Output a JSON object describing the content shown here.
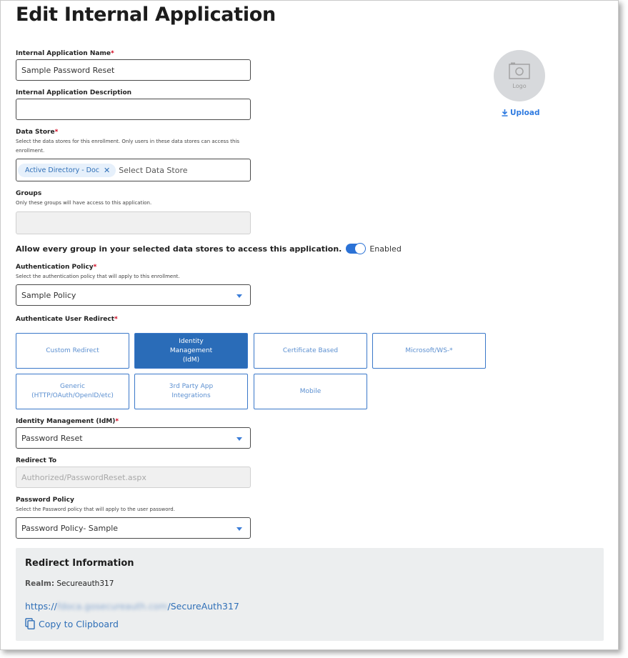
{
  "page_title": "Edit Internal Application",
  "app_name": {
    "label": "Internal Application Name",
    "value": "Sample Password Reset"
  },
  "app_description": {
    "label": "Internal Application Description",
    "value": ""
  },
  "data_store": {
    "label": "Data Store",
    "help": "Select the data stores for this enrollment. Only users in these data stores can access this enrollment.",
    "chip": "Active Directory - Doc",
    "placeholder": "Select Data Store"
  },
  "groups": {
    "label": "Groups",
    "help": "Only these groups will have access to this application.",
    "value": ""
  },
  "allow_all_groups": {
    "label": "Allow every group in your selected data stores to access this application.",
    "state": "Enabled",
    "on": true
  },
  "auth_policy": {
    "label": "Authentication Policy",
    "help": "Select the authentication policy that will apply to this enrollment.",
    "value": "Sample Policy"
  },
  "auth_redirect": {
    "label": "Authenticate User Redirect",
    "options": [
      "Custom Redirect",
      "Identity Management (IdM)",
      "Certificate Based",
      "Microsoft/WS-*",
      "Generic (HTTP/OAuth/OpenID/etc)",
      "3rd Party App Integrations",
      "Mobile"
    ],
    "selected": "Identity Management (IdM)"
  },
  "idm": {
    "label": "Identity Management (IdM)",
    "value": "Password Reset"
  },
  "redirect_to": {
    "label": "Redirect To",
    "value": "Authorized/PasswordReset.aspx"
  },
  "password_policy": {
    "label": "Password Policy",
    "help": "Select the Password policy that will apply to the user password.",
    "value": "Password Policy- Sample"
  },
  "logo": {
    "text": "Logo",
    "upload_label": "Upload"
  },
  "redirect_info": {
    "title": "Redirect Information",
    "realm_label": "Realm:",
    "realm_value": "Secureauth317",
    "url_prefix": "https://",
    "url_host_obscured": "fdoca.gosecureauth.com",
    "url_path": "/SecureAuth317",
    "copy_label": "Copy to Clipboard"
  },
  "colors": {
    "accent": "#2a6cb8",
    "required": "#d0021b",
    "link": "#2f6fb7"
  },
  "icons": {
    "logo_placeholder": "camera-icon",
    "upload": "download-arrow-icon",
    "chip_remove": "close-icon",
    "select": "caret-down-icon",
    "copy": "copy-icon"
  }
}
